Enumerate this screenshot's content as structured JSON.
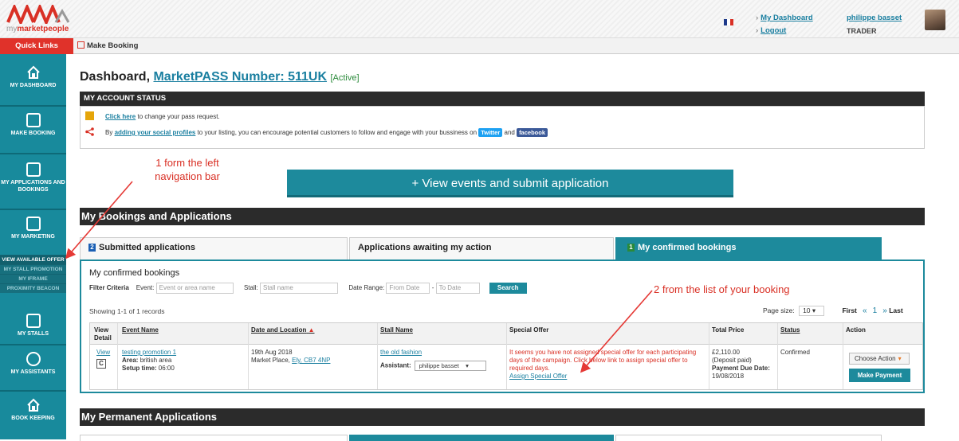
{
  "colors": {
    "brand_teal": "#1d8a9c",
    "brand_red": "#d93025",
    "dark_header": "#2b2b2b"
  },
  "header": {
    "logo_text_my": "my",
    "logo_text_brand": "marketpeople",
    "flag_icon": "france-flag-icon",
    "links": {
      "dashboard": "My Dashboard",
      "logout": "Logout"
    },
    "user_name": "philippe basset",
    "user_role": "TRADER"
  },
  "subbar": {
    "quick_links": "Quick Links",
    "make_booking": "Make Booking"
  },
  "sidebar": {
    "items": [
      {
        "label": "MY DASHBOARD",
        "icon": "home-icon"
      },
      {
        "label": "MAKE BOOKING",
        "icon": "calendar-icon"
      },
      {
        "label": "MY APPLICATIONS AND BOOKINGS",
        "icon": "calendar-check-icon"
      },
      {
        "label": "MY MARKETING",
        "icon": "calendar-check-icon"
      },
      {
        "label": "MY STALLS",
        "icon": "stall-icon"
      },
      {
        "label": "MY ASSISTANTS",
        "icon": "user-icon"
      },
      {
        "label": "BOOK KEEPING",
        "icon": "home-icon"
      }
    ],
    "sub_items": [
      "VIEW AVAILABLE OFFER",
      "MY STALL PROMOTION",
      "MY IFRAME",
      "PROXIMITY BEACON"
    ]
  },
  "dashboard": {
    "title": "Dashboard,",
    "pass_label": "MarketPASS Number: 511UK",
    "status": "[Active]"
  },
  "account_status": {
    "heading": "MY ACCOUNT STATUS",
    "row1": {
      "link": "Click here",
      "text": " to change your pass request."
    },
    "row2": {
      "prefix": "By ",
      "link": "adding your social profiles",
      "text": " to your listing, you can encourage potential customers to follow and engage with your bussiness on ",
      "twitter": "Twitter",
      "and": " and ",
      "facebook": "facebook"
    }
  },
  "annotations": {
    "one_line1": "1 form the left",
    "one_line2": "navigation bar",
    "two": "2 from the list of your booking"
  },
  "view_events_button": "+ View events and submit application",
  "bookings": {
    "heading": "My Bookings and Applications",
    "tabs": [
      {
        "count": "2",
        "label": "Submitted applications"
      },
      {
        "count": "",
        "label": "Applications awaiting my action"
      },
      {
        "count": "1",
        "label": "My confirmed bookings"
      }
    ],
    "panel_title": "My confirmed bookings",
    "filter": {
      "label": "Filter Criteria",
      "event_label": "Event:",
      "event_placeholder": "Event or area name",
      "stall_label": "Stall:",
      "stall_placeholder": "Stall name",
      "date_label": "Date Range:",
      "from_placeholder": "From Date",
      "dash": "-",
      "to_placeholder": "To Date",
      "search": "Search"
    },
    "showing": "Showing 1-1 of 1 records",
    "page_size_label": "Page size:",
    "page_size": "10",
    "pager": {
      "first": "First",
      "prev": "«",
      "page": "1",
      "next": "»",
      "last": "Last"
    },
    "columns": {
      "view": "View Detail",
      "event": "Event Name",
      "date": "Date and Location",
      "sort": "▲",
      "stall": "Stall Name",
      "offer": "Special Offer",
      "price": "Total Price",
      "status": "Status",
      "action": "Action"
    },
    "row": {
      "view": "View",
      "c": "C",
      "event_name": "testing promotion 1",
      "area_label": "Area:",
      "area": "british area",
      "setup_label": "Setup time:",
      "setup": "06:00",
      "date": "19th Aug 2018",
      "location": "Market Place,",
      "location_link": "Ely, CB7 4NP",
      "stall": "the old fashion",
      "assistant_label": "Assistant:",
      "assistant": "philippe basset",
      "offer_text": "It seems you have not assigned special offer for each participating days of the campaign. Click below link to assign special offer to required days.",
      "offer_link": "Assign Special Offer",
      "price": "£2,110.00",
      "deposit": "(Deposit paid)",
      "due_label": "Payment Due Date:",
      "due": "19/08/2018",
      "status": "Confirmed",
      "choose": "Choose Action",
      "pay": "Make Payment"
    }
  },
  "permanent": {
    "heading": "My Permanent Applications"
  }
}
